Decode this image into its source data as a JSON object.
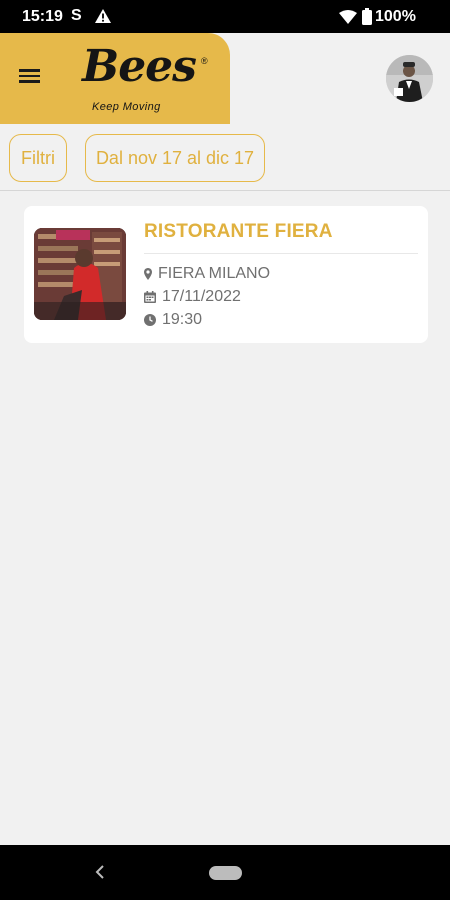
{
  "status_bar": {
    "time": "15:19",
    "app_icon": "S",
    "battery": "100%"
  },
  "header": {
    "logo_text": "Bees",
    "logo_registered": "®",
    "logo_tagline": "Keep Moving",
    "brand_color": "#e6b94a"
  },
  "filters": {
    "filter_label": "Filtri",
    "date_range_label": "Dal nov 17 al dic 17"
  },
  "events": [
    {
      "title": "RISTORANTE FIERA",
      "location": "FIERA MILANO",
      "date": "17/11/2022",
      "time": "19:30"
    }
  ],
  "icons": {
    "menu": "hamburger-icon",
    "location": "map-pin-icon",
    "date": "calendar-icon",
    "time": "clock-icon",
    "back": "chevron-left-icon"
  }
}
